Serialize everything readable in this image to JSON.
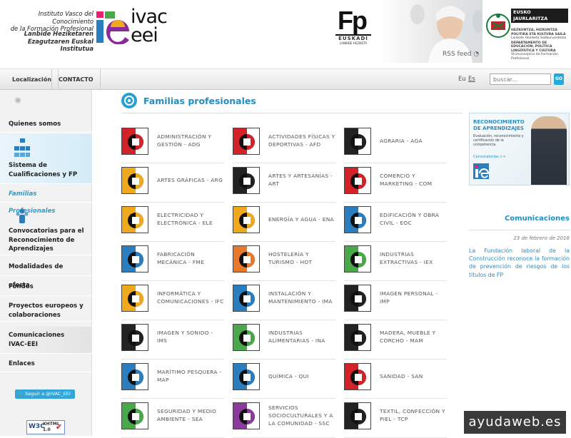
{
  "header": {
    "inst_es_1": "Instituto Vasco del Conocimiento",
    "inst_es_2": "de la Formación Profesional",
    "inst_eu_1": "Lanbide Heziketaren",
    "inst_eu_2": "Ezagutzaren Euskal Institutua",
    "logo_ivac": "ivac",
    "logo_eei": "eei",
    "fp_logo": "Fp",
    "fp_sub": "EUSKADI",
    "fp_sub2": "LANBIDE HEZIKETA",
    "rss": "RSS feed",
    "gov_1": "EUSKO JAURLARITZA",
    "gov_2": "GOBIERNO VASCO",
    "gov_dept_1": "HEZKUNTZA, HIZKUNTZA POLITIKA ETA KULTURA SAILA",
    "gov_dept_2": "Lanbide Heziketa Sailburuordetza",
    "gov_dept_3": "DEPARTAMENTO DE EDUCACIÓN, POLÍTICA LINGÜÍSTICA Y CULTURA",
    "gov_dept_4": "Viceconsejería de Formación Profesional"
  },
  "nav": {
    "localizacion": "Localización",
    "contacto": "CONTACTO",
    "lang_eu": "Eu",
    "lang_es": "Es",
    "search_placeholder": "buscar...",
    "go": "GO"
  },
  "sidebar": {
    "items": [
      "Quienes somos",
      "Sistema de Cualificaciones y FP",
      "Familias Profesionales",
      "Convocatorias para el Reconocimiento de Aprendizajes",
      "Modalidades de oferta",
      "Fondos",
      "Proyectos europeos y colaboraciones",
      "Comunicaciones IVAC-EEI",
      "Enlaces"
    ],
    "twitter": "Seguir a @IVAC_EEI",
    "w3c_1": "W3C",
    "w3c_2": "XHTML",
    "w3c_3": "1.0"
  },
  "main": {
    "title": "Familias profesionales",
    "families": [
      {
        "label": "ADMINISTRACIÓN Y GESTIÓN - ADG",
        "icon": "office-icon",
        "color": "#d2232a"
      },
      {
        "label": "ACTIVIDADES FÍSICAS Y DEPORTIVAS - AFD",
        "icon": "sports-icon",
        "color": "#d2232a"
      },
      {
        "label": "AGRARIA - AGA",
        "icon": "agrarian-icon",
        "color": "#222222"
      },
      {
        "label": "ARTES GRÁFICAS - ARG",
        "icon": "graphic-arts-icon",
        "color": "#f0a81c"
      },
      {
        "label": "ARTES Y ARTESANÍAS - ART",
        "icon": "crafts-icon",
        "color": "#222222"
      },
      {
        "label": "COMERCIO Y MARKETING - COM",
        "icon": "commerce-icon",
        "color": "#d2232a"
      },
      {
        "label": "ELECTRICIDAD Y ELECTRÓNICA - ELE",
        "icon": "electricity-icon",
        "color": "#f0a81c"
      },
      {
        "label": "ENERGÍA Y AGUA - ENA",
        "icon": "energy-water-icon",
        "color": "#f0a81c"
      },
      {
        "label": "EDIFICACIÓN Y OBRA CIVIL - EOC",
        "icon": "building-icon",
        "color": "#2a7ec0"
      },
      {
        "label": "FABRICACIÓN MECÁNICA - FME",
        "icon": "gear-icon",
        "color": "#2a7ec0"
      },
      {
        "label": "HOSTELERÍA Y TURISMO - HOT",
        "icon": "hospitality-icon",
        "color": "#e8792a"
      },
      {
        "label": "INDUSTRIAS EXTRACTIVAS - IEX",
        "icon": "mining-icon",
        "color": "#4aa84a"
      },
      {
        "label": "INFORMÁTICA Y COMUNICACIONES - IFC",
        "icon": "computing-icon",
        "color": "#f0a81c"
      },
      {
        "label": "INSTALACIÓN Y MANTENIMIENTO - IMA",
        "icon": "maintenance-icon",
        "color": "#2a7ec0"
      },
      {
        "label": "IMAGEN PERSONAL - IMP",
        "icon": "personal-image-icon",
        "color": "#222222"
      },
      {
        "label": "IMAGEN Y SONIDO - IMS",
        "icon": "film-reel-icon",
        "color": "#222222"
      },
      {
        "label": "INDUSTRIAS ALIMENTARIAS - INA",
        "icon": "food-industry-icon",
        "color": "#4aa84a"
      },
      {
        "label": "MADERA, MUEBLE Y CORCHO - MAM",
        "icon": "wood-icon",
        "color": "#222222"
      },
      {
        "label": "MARÍTIMO PESQUERA - MAP",
        "icon": "maritime-icon",
        "color": "#2a7ec0"
      },
      {
        "label": "QUÍMICA - QUI",
        "icon": "chemistry-icon",
        "color": "#2a7ec0"
      },
      {
        "label": "SANIDAD - SAN",
        "icon": "health-icon",
        "color": "#d2232a"
      },
      {
        "label": "SEGURIDAD Y MEDIO AMBIENTE - SEA",
        "icon": "environment-icon",
        "color": "#4aa84a"
      },
      {
        "label": "SERVICIOS SOCIOCULTURALES Y A LA COMUNIDAD - SSC",
        "icon": "community-icon",
        "color": "#8a3a9a"
      },
      {
        "label": "TEXTIL, CONFECCIÓN Y PIEL - TCP",
        "icon": "textile-icon",
        "color": "#222222"
      }
    ]
  },
  "right": {
    "banner_title_1": "RECONOCIMIENTO",
    "banner_title_2": "DE APRENDIZAJES",
    "banner_sub": "Evaluación, reconocimiento y certificación de la competencia.",
    "banner_link": "Convocatorias >>",
    "comm_title": "Comunicaciones",
    "comm_date": "23 de febrero de 2016",
    "comm_text": "La Fundación laboral de la Construcción reconoce la formación de prevención de riesgos de los títulos de FP"
  },
  "watermark": "ayudaweb.es"
}
